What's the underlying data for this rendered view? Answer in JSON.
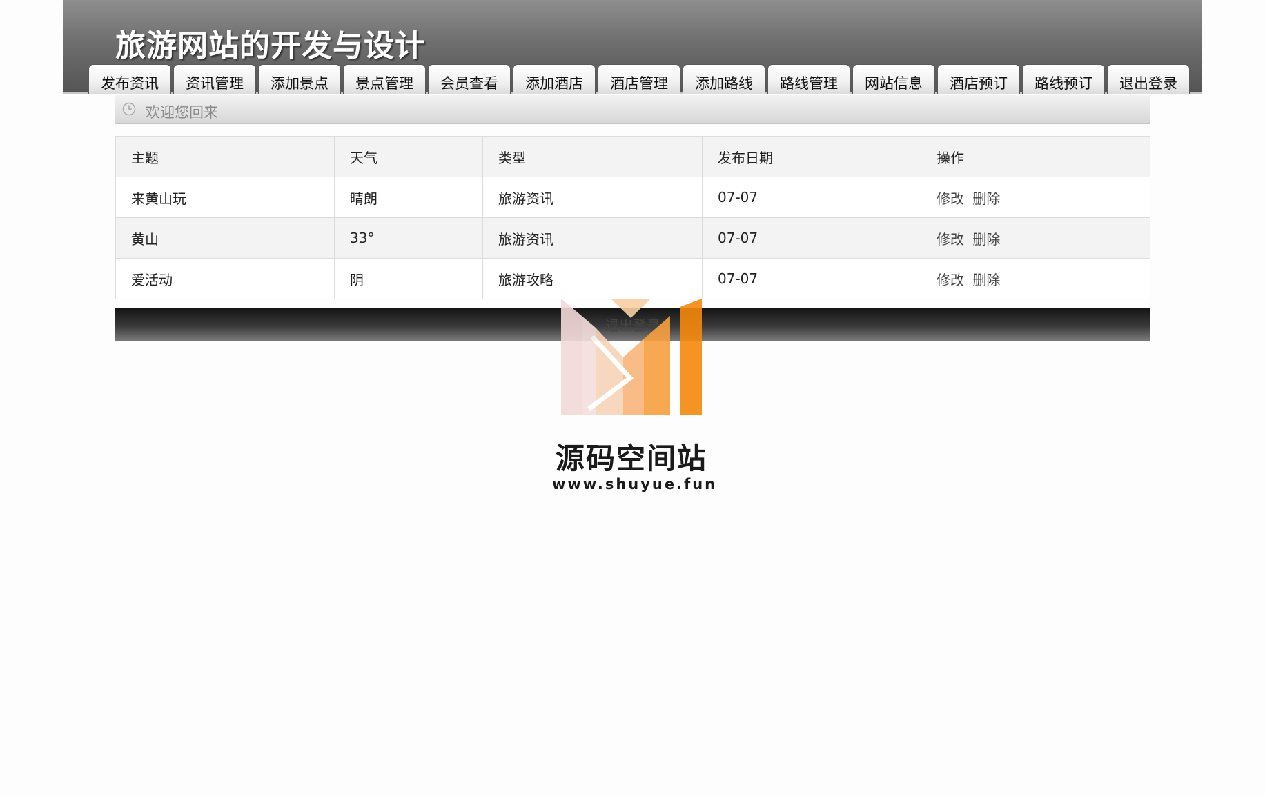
{
  "header": {
    "site_title": "旅游网站的开发与设计"
  },
  "nav": {
    "tabs": [
      {
        "label": "发布资讯"
      },
      {
        "label": "资讯管理"
      },
      {
        "label": "添加景点"
      },
      {
        "label": "景点管理"
      },
      {
        "label": "会员查看"
      },
      {
        "label": "添加酒店"
      },
      {
        "label": "酒店管理"
      },
      {
        "label": "添加路线"
      },
      {
        "label": "路线管理"
      },
      {
        "label": "网站信息"
      },
      {
        "label": "酒店预订"
      },
      {
        "label": "路线预订"
      },
      {
        "label": "退出登录"
      }
    ]
  },
  "welcome": {
    "icon": "clock-icon",
    "text": "欢迎您回来"
  },
  "table": {
    "headers": [
      "主题",
      "天气",
      "类型",
      "发布日期",
      "操作"
    ],
    "rows": [
      {
        "topic": "来黄山玩",
        "weather": "晴朗",
        "type": "旅游资讯",
        "date": "07-07",
        "edit": "修改",
        "delete": "删除"
      },
      {
        "topic": "黄山",
        "weather": "33°",
        "type": "旅游资讯",
        "date": "07-07",
        "edit": "修改",
        "delete": "删除"
      },
      {
        "topic": "爱活动",
        "weather": "阴",
        "type": "旅游攻略",
        "date": "07-07",
        "edit": "修改",
        "delete": "删除"
      }
    ]
  },
  "footer": {
    "logout_label": "退出登录"
  },
  "watermark": {
    "name": "源码空间站",
    "url": "www.shuyue.fun"
  },
  "colors": {
    "header_gradient_top": "#8e8e8e",
    "header_gradient_bottom": "#555555",
    "welcome_text": "#8a8a8a",
    "watermark_orange": "#f5890d"
  }
}
